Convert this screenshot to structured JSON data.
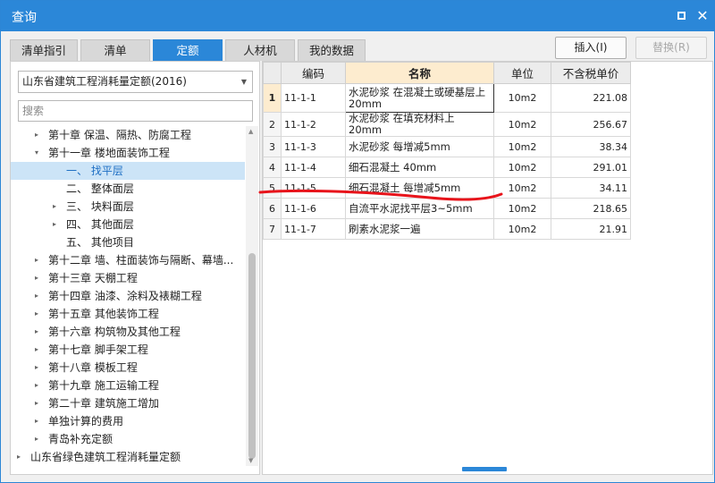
{
  "window": {
    "title": "查询",
    "accent": "#2b87d8"
  },
  "tabs": [
    {
      "label": "清单指引",
      "active": false
    },
    {
      "label": "清单",
      "active": false
    },
    {
      "label": "定额",
      "active": true
    },
    {
      "label": "人材机",
      "active": false
    },
    {
      "label": "我的数据",
      "active": false
    }
  ],
  "toolbar": {
    "insert_label": "插入(I)",
    "replace_label": "替换(R)"
  },
  "left": {
    "quota_select": "山东省建筑工程消耗量定额(2016)",
    "search_placeholder": "搜索",
    "tree": [
      {
        "label": "第十章 保温、隔热、防腐工程",
        "caret": "▸",
        "level": 1
      },
      {
        "label": "第十一章 楼地面装饰工程",
        "caret": "▾",
        "level": 1
      },
      {
        "label": "一、 找平层",
        "caret": "",
        "level": 2,
        "selected": true
      },
      {
        "label": "二、 整体面层",
        "caret": "",
        "level": 2
      },
      {
        "label": "三、 块料面层",
        "caret": "▸",
        "level": 2
      },
      {
        "label": "四、 其他面层",
        "caret": "▸",
        "level": 2
      },
      {
        "label": "五、 其他项目",
        "caret": "",
        "level": 2
      },
      {
        "label": "第十二章 墙、柱面装饰与隔断、幕墙...",
        "caret": "▸",
        "level": 1
      },
      {
        "label": "第十三章 天棚工程",
        "caret": "▸",
        "level": 1
      },
      {
        "label": "第十四章 油漆、涂料及裱糊工程",
        "caret": "▸",
        "level": 1
      },
      {
        "label": "第十五章 其他装饰工程",
        "caret": "▸",
        "level": 1
      },
      {
        "label": "第十六章 构筑物及其他工程",
        "caret": "▸",
        "level": 1
      },
      {
        "label": "第十七章 脚手架工程",
        "caret": "▸",
        "level": 1
      },
      {
        "label": "第十八章 模板工程",
        "caret": "▸",
        "level": 1
      },
      {
        "label": "第十九章 施工运输工程",
        "caret": "▸",
        "level": 1
      },
      {
        "label": "第二十章 建筑施工增加",
        "caret": "▸",
        "level": 1
      },
      {
        "label": "单独计算的费用",
        "caret": "▸",
        "level": 1
      },
      {
        "label": "青岛补充定额",
        "caret": "▸",
        "level": 1
      },
      {
        "label": "山东省绿色建筑工程消耗量定额",
        "caret": "▸",
        "level": 0
      }
    ]
  },
  "table": {
    "headers": {
      "code": "编码",
      "name": "名称",
      "unit": "单位",
      "price": "不含税单价"
    },
    "rows": [
      {
        "idx": "1",
        "code": "11-1-1",
        "name": "水泥砂浆 在混凝土或硬基层上 20mm",
        "unit": "10m2",
        "price": "221.08"
      },
      {
        "idx": "2",
        "code": "11-1-2",
        "name": "水泥砂浆 在填充材料上 20mm",
        "unit": "10m2",
        "price": "256.67"
      },
      {
        "idx": "3",
        "code": "11-1-3",
        "name": "水泥砂浆 每增减5mm",
        "unit": "10m2",
        "price": "38.34"
      },
      {
        "idx": "4",
        "code": "11-1-4",
        "name": "细石混凝土 40mm",
        "unit": "10m2",
        "price": "291.01"
      },
      {
        "idx": "5",
        "code": "11-1-5",
        "name": "细石混凝土 每增减5mm",
        "unit": "10m2",
        "price": "34.11"
      },
      {
        "idx": "6",
        "code": "11-1-6",
        "name": "自流平水泥找平层3~5mm",
        "unit": "10m2",
        "price": "218.65"
      },
      {
        "idx": "7",
        "code": "11-1-7",
        "name": "刷素水泥浆一遍",
        "unit": "10m2",
        "price": "21.91"
      }
    ]
  },
  "annotation_color": "#e8141b"
}
